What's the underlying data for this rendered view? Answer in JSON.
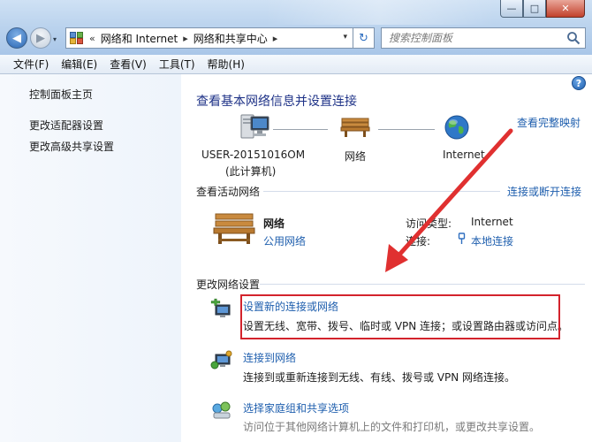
{
  "window": {
    "controls": {
      "minimize_glyph": "—",
      "maximize_glyph": "□",
      "close_glyph": "✕"
    }
  },
  "nav": {
    "back_glyph": "◀",
    "forward_glyph": "▶",
    "history_glyph": "▾"
  },
  "address": {
    "prefix": "«",
    "crumbs": [
      "网络和 Internet",
      "网络和共享中心"
    ],
    "separator": "▸",
    "dropdown_glyph": "▾",
    "refresh_glyph": "↻"
  },
  "search": {
    "placeholder": "搜索控制面板"
  },
  "menu": [
    "文件(F)",
    "编辑(E)",
    "查看(V)",
    "工具(T)",
    "帮助(H)"
  ],
  "sidebar": {
    "items": [
      {
        "label": "控制面板主页"
      },
      {
        "label": "更改适配器设置"
      },
      {
        "label": "更改高级共享设置"
      }
    ]
  },
  "main": {
    "help_glyph": "?",
    "heading": "查看基本网络信息并设置连接",
    "full_map_link": "查看完整映射",
    "map": {
      "computer_name": "USER-20151016OM",
      "computer_note": "(此计算机)",
      "network_label": "网络",
      "internet_label": "Internet"
    },
    "active": {
      "title": "查看活动网络",
      "connect_link": "连接或断开连接",
      "network_name": "网络",
      "network_type": "公用网络",
      "access_type_label": "访问类型:",
      "access_type_value": "Internet",
      "connection_label": "连接:",
      "connection_value": "本地连接"
    },
    "change": {
      "title": "更改网络设置",
      "items": [
        {
          "title": "设置新的连接或网络",
          "desc": "设置无线、宽带、拨号、临时或 VPN 连接；或设置路由器或访问点。"
        },
        {
          "title": "连接到网络",
          "desc": "连接到或重新连接到无线、有线、拨号或 VPN 网络连接。"
        },
        {
          "title": "选择家庭组和共享选项",
          "desc": "访问位于其他网络计算机上的文件和打印机，或更改共享设置。"
        }
      ]
    }
  },
  "colors": {
    "heading": "#1e3287",
    "link": "#1f5fae",
    "highlight": "#d3232c",
    "arrow": "#e03030"
  }
}
